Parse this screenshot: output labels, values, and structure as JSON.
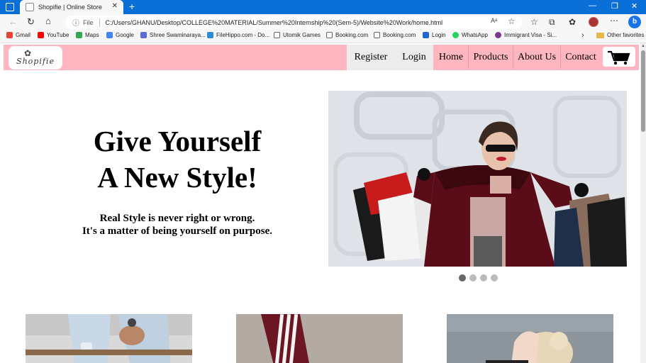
{
  "browser": {
    "tab_title": "Shopifie | Online Store",
    "tab_close": "✕",
    "new_tab": "+",
    "window_controls": [
      "—",
      "❐",
      "✕"
    ],
    "url_scheme": "File",
    "url": "C:/Users/GHANU/Desktop/COLLEGE%20MATERIAL/Summer%20Internship%20(Sem-5)/Website%20Work/home.html",
    "bing_label": "b"
  },
  "bookmarks": [
    {
      "label": "Gmail",
      "color": "#ea4335"
    },
    {
      "label": "YouTube",
      "color": "#ff0000"
    },
    {
      "label": "Maps",
      "color": "#34a853"
    },
    {
      "label": "Google",
      "color": "#4285f4"
    },
    {
      "label": "Shree Swaminaraya...",
      "color": "#5b6bd6"
    },
    {
      "label": "FileHippo.com - Do...",
      "color": "#2e8bd8"
    },
    {
      "label": "Utomik Games",
      "color": "#ffffff"
    },
    {
      "label": "Booking.com",
      "color": "#ffffff"
    },
    {
      "label": "Booking.com",
      "color": "#ffffff"
    },
    {
      "label": "Login",
      "color": "#2266cc"
    },
    {
      "label": "WhatsApp",
      "color": "#25d366"
    },
    {
      "label": "Immigrant Visa - Si...",
      "color": "#7a3b8f"
    }
  ],
  "bookmarks_folder": "Other favorites",
  "site": {
    "logo_text": "Shopifie",
    "nav": [
      "Register",
      "Login",
      "Home",
      "Products",
      "About Us",
      "Contact"
    ],
    "cart_icon": "shopping-cart",
    "brand_color": "#ffb6c1"
  },
  "hero": {
    "title_line1": "Give Yourself",
    "title_line2": "A New Style!",
    "subtitle_line1": "Real Style is never right or wrong.",
    "subtitle_line2": "It's a matter of being yourself on purpose.",
    "carousel_slide_count": 4,
    "carousel_active_index": 0
  }
}
